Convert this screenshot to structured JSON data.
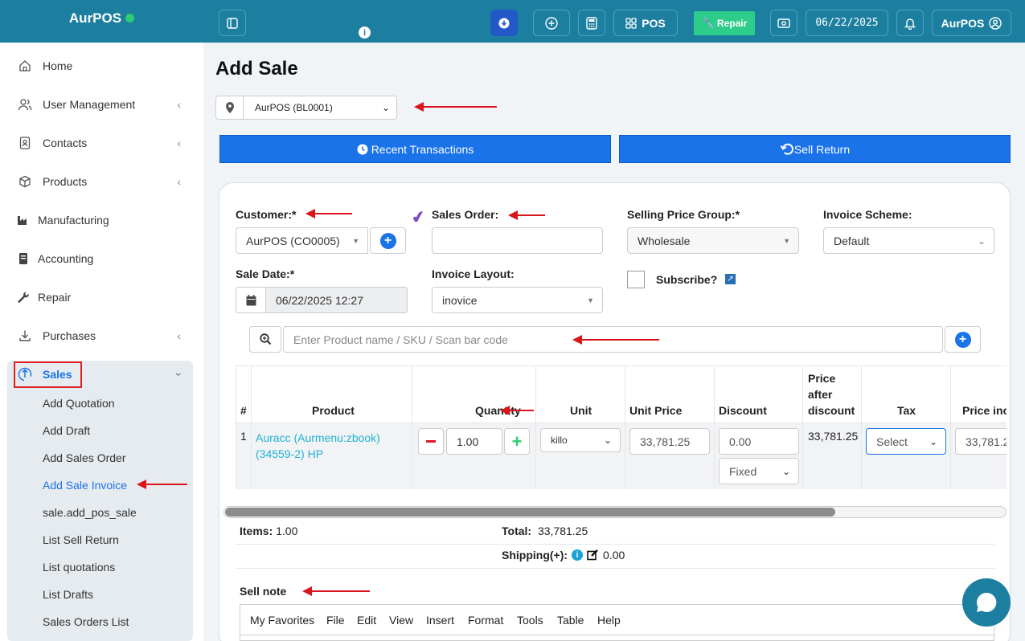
{
  "app": {
    "brand": "AurPOS"
  },
  "topbar": {
    "pos_label": "POS",
    "repair_label": "Repair",
    "date": "06/22/2025",
    "user": "AurPOS",
    "info_glyph": "i"
  },
  "sidebar": {
    "items": [
      {
        "label": "Home",
        "icon": "home-icon"
      },
      {
        "label": "User Management",
        "icon": "users-icon"
      },
      {
        "label": "Contacts",
        "icon": "contacts-icon"
      },
      {
        "label": "Products",
        "icon": "box-icon"
      },
      {
        "label": "Manufacturing",
        "icon": "factory-icon"
      },
      {
        "label": "Accounting",
        "icon": "book-icon"
      },
      {
        "label": "Repair",
        "icon": "wrench-icon"
      },
      {
        "label": "Purchases",
        "icon": "download-icon"
      },
      {
        "label": "Sales",
        "icon": "upload-icon"
      }
    ],
    "sales_submenu": [
      "Add Quotation",
      "Add Draft",
      "Add Sales Order",
      "Add Sale Invoice",
      "sale.add_pos_sale",
      "List Sell Return",
      "List quotations",
      "List Drafts",
      "Sales Orders List"
    ]
  },
  "page": {
    "title": "Add Sale",
    "location": "AurPOS (BL0001)",
    "recent_transactions": "Recent Transactions",
    "sell_return": "Sell Return"
  },
  "form": {
    "customer_label": "Customer:*",
    "customer_value": "AurPOS (CO0005)",
    "sales_order_label": "Sales Order:",
    "selling_price_group_label": "Selling Price Group:*",
    "selling_price_group_value": "Wholesale",
    "invoice_scheme_label": "Invoice Scheme:",
    "invoice_scheme_value": "Default",
    "sale_date_label": "Sale Date:*",
    "sale_date_value": "06/22/2025 12:27",
    "invoice_layout_label": "Invoice Layout:",
    "invoice_layout_value": "inovice",
    "subscribe_label": "Subscribe?",
    "search_placeholder": "Enter Product name / SKU / Scan bar code"
  },
  "table": {
    "headers": {
      "num": "#",
      "product": "Product",
      "quantity": "Quantity",
      "unit": "Unit",
      "unit_price": "Unit Price",
      "discount": "Discount",
      "price_after_1": "Price",
      "price_after_2": "after",
      "price_after_3": "discount",
      "tax": "Tax",
      "price_inc": "Price inc"
    },
    "row": {
      "num": "1",
      "product_1": "Auracc (Aurmenu:zbook)",
      "product_2": "(34559-2) HP",
      "qty": "1.00",
      "unit": "killo",
      "unit_price": "33,781.25",
      "discount": "0.00",
      "discount_type": "Fixed",
      "price_after": "33,781.25",
      "tax": "Select",
      "price_inc": "33,781.2"
    }
  },
  "totals": {
    "items_label": "Items:",
    "items_value": "1.00",
    "total_label": "Total:",
    "total_value": "33,781.25",
    "shipping_label": "Shipping(+):",
    "shipping_value": "0.00"
  },
  "sell_note": {
    "label": "Sell note",
    "menu": [
      "My Favorites",
      "File",
      "Edit",
      "View",
      "Insert",
      "Format",
      "Tools",
      "Table",
      "Help"
    ]
  },
  "colors": {
    "topbar": "#1c7fa0",
    "primary": "#1a73e8",
    "annotation": "#d9141b",
    "repair": "#2ecc8a"
  }
}
